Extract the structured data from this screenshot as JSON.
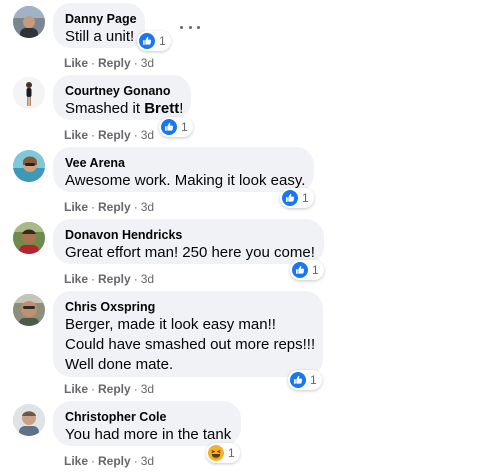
{
  "comments": [
    {
      "author": "Danny Page",
      "text": "Still a unit!",
      "reaction_count": "1",
      "reaction_icon": "like-icon",
      "like_label": "Like",
      "reply_label": "Reply",
      "time": "3d"
    },
    {
      "author": "Courtney Gonano",
      "text_before": "Smashed it ",
      "mention": "Brett",
      "text_after": "!",
      "reaction_count": "1",
      "reaction_icon": "like-icon",
      "like_label": "Like",
      "reply_label": "Reply",
      "time": "3d"
    },
    {
      "author": "Vee Arena",
      "text": "Awesome work. Making it look easy.",
      "reaction_count": "1",
      "reaction_icon": "like-icon",
      "like_label": "Like",
      "reply_label": "Reply",
      "time": "3d"
    },
    {
      "author": "Donavon Hendricks",
      "text": "Great effort man! 250 here you come!",
      "reaction_count": "1",
      "reaction_icon": "like-icon",
      "like_label": "Like",
      "reply_label": "Reply",
      "time": "3d"
    },
    {
      "author": "Chris Oxspring",
      "lines": [
        "Berger, made it look easy man!!",
        "Could have smashed out more reps!!!",
        "Well done mate."
      ],
      "reaction_count": "1",
      "reaction_icon": "like-icon",
      "like_label": "Like",
      "reply_label": "Reply",
      "time": "3d"
    },
    {
      "author": "Christopher Cole",
      "text": "You had more in the tank",
      "reaction_count": "1",
      "reaction_icon": "haha-icon",
      "like_label": "Like",
      "reply_label": "Reply",
      "time": "3d"
    }
  ],
  "separator": "·",
  "colors": {
    "bubble": "#f0f2f5",
    "like_blue": "#1877f2",
    "haha_yellow": "#f7b125",
    "meta_gray": "#65676b"
  }
}
